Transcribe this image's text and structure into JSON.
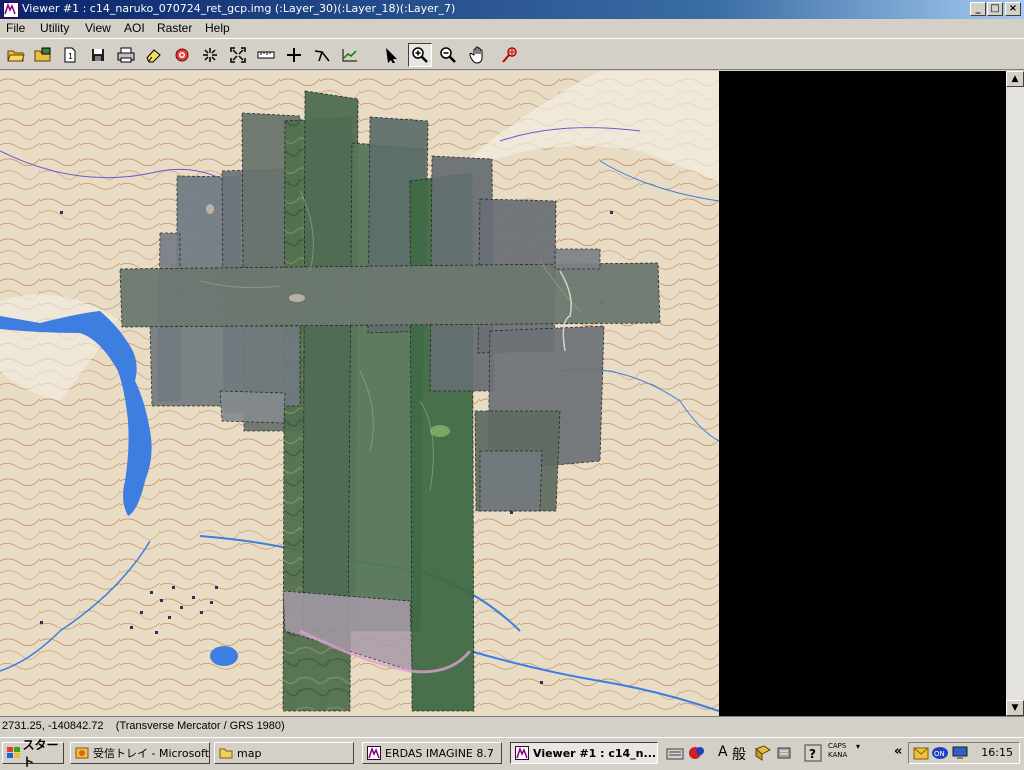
{
  "window": {
    "title": "Viewer #1 : c14_naruko_070724_ret_gcp.img (:Layer_30)(:Layer_18)(:Layer_7)",
    "controls": {
      "minimize": "_",
      "maximize": "□",
      "close": "×"
    }
  },
  "menu": [
    {
      "label": "File"
    },
    {
      "label": "Utility"
    },
    {
      "label": "View"
    },
    {
      "label": "AOI"
    },
    {
      "label": "Raster"
    },
    {
      "label": "Help"
    }
  ],
  "toolbar": {
    "tools": [
      "open-folder-icon",
      "open-layer-icon",
      "new-document-icon",
      "save-icon",
      "print-icon",
      "eraser-icon",
      "target-icon",
      "zoom-in-cross-icon",
      "zoom-fit-icon",
      "measure-ruler-icon",
      "crosshair-icon",
      "arc-tool-icon",
      "profile-icon",
      "select-arrow-icon",
      "zoom-in-icon",
      "zoom-out-icon",
      "pan-hand-icon",
      "inquire-icon"
    ],
    "active_tool": "zoom-in-icon"
  },
  "status": {
    "coordinates": "2731.25, -140842.72",
    "projection": "(Transverse Mercator / GRS 1980)"
  },
  "taskbar": {
    "start_label": "スタート",
    "tasks": [
      {
        "label": "受信トレイ - Microsoft ...",
        "icon": "outlook-icon"
      },
      {
        "label": "map",
        "icon": "folder-icon"
      },
      {
        "label": "ERDAS IMAGINE 8.7",
        "icon": "erdas-icon"
      },
      {
        "label": "Viewer #1 : c14_n...",
        "icon": "erdas-viewer-icon",
        "active": true
      }
    ],
    "ime": {
      "mode": "A",
      "conversion": "般",
      "caps": "CAPS",
      "kana": "KANA"
    },
    "tray_expand": "«",
    "clock": "16:15"
  },
  "colors": {
    "titlebar_start": "#0a246a",
    "titlebar_end": "#a6caf0",
    "chrome": "#d4d0c8",
    "map_paper": "#e8dcc8",
    "water": "#3d7ee0",
    "viewer_background": "#000000"
  }
}
